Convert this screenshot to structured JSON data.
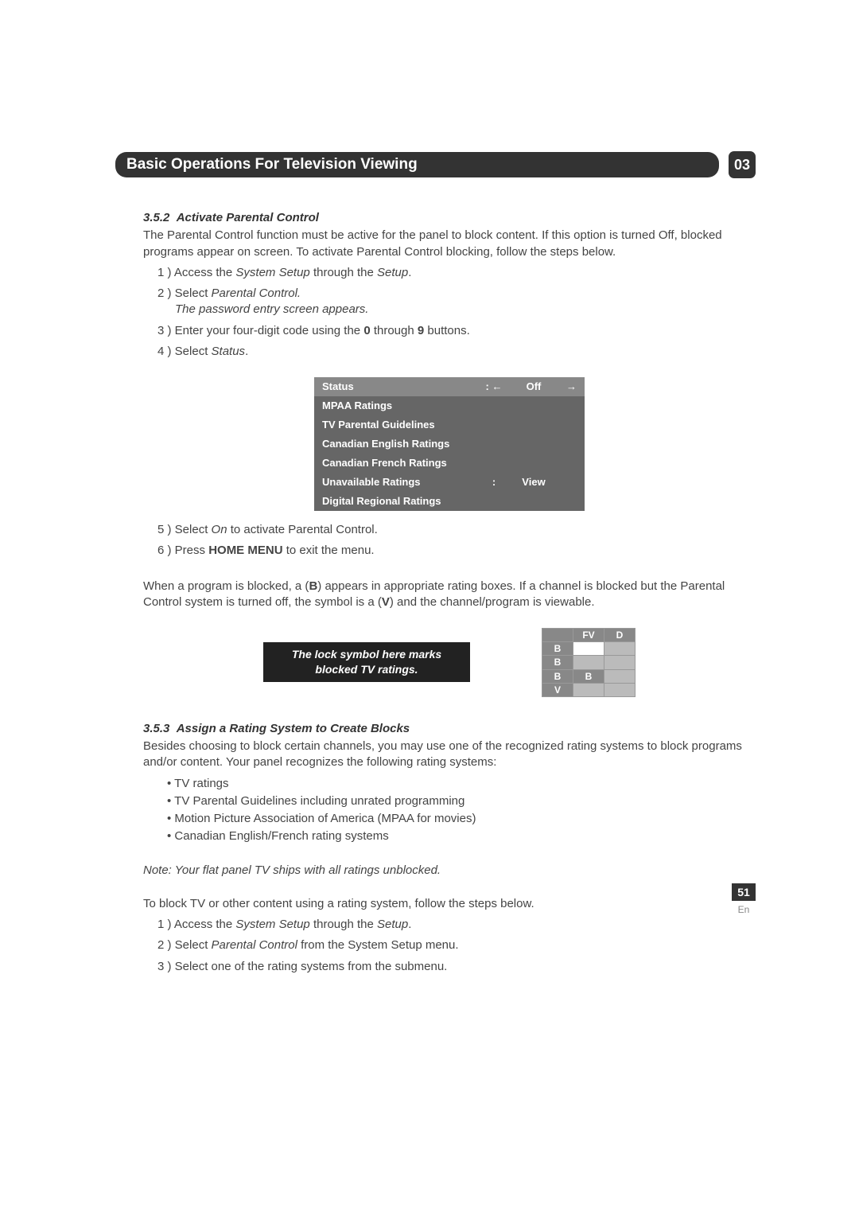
{
  "header": {
    "title": "Basic Operations For Television Viewing",
    "chapter": "03"
  },
  "section1": {
    "number": "3.5.2",
    "title": "Activate Parental Control",
    "intro": "The Parental Control function must be active for the panel to block content. If this option is turned Off, blocked programs appear on screen. To activate Parental Control blocking, follow the steps below.",
    "step1_a": "1 ) Access the ",
    "step1_b": "System Setup",
    "step1_c": " through the ",
    "step1_d": "Setup",
    "step1_e": ".",
    "step2_a": "2 ) Select ",
    "step2_b": "Parental Control.",
    "step2_note": "The password entry screen appears.",
    "step3_a": "3 ) Enter your four-digit code using the ",
    "step3_b": "0",
    "step3_c": " through ",
    "step3_d": "9",
    "step3_e": " buttons.",
    "step4_a": "4 ) Select ",
    "step4_b": "Status",
    "step4_c": ".",
    "step5_a": "5 ) Select ",
    "step5_b": "On",
    "step5_c": " to activate Parental Control.",
    "step6_a": "6 ) Press ",
    "step6_b": "HOME MENU",
    "step6_c": " to exit the menu.",
    "blocked_a": "When a program is blocked, a (",
    "blocked_b": "B",
    "blocked_c": ") appears in appropriate rating boxes. If a channel is blocked but the Parental Control system is turned off, the symbol is a (",
    "blocked_d": "V",
    "blocked_e": ") and the channel/program is viewable."
  },
  "menu": {
    "rows": [
      {
        "label": "Status",
        "arrow": ": ←",
        "value": "Off",
        "arrow2": "→",
        "hl": true
      },
      {
        "label": "MPAA Ratings",
        "arrow": "",
        "value": "",
        "arrow2": "",
        "hl": false
      },
      {
        "label": "TV Parental Guidelines",
        "arrow": "",
        "value": "",
        "arrow2": "",
        "hl": false
      },
      {
        "label": "Canadian English Ratings",
        "arrow": "",
        "value": "",
        "arrow2": "",
        "hl": false
      },
      {
        "label": "Canadian French Ratings",
        "arrow": "",
        "value": "",
        "arrow2": "",
        "hl": false
      },
      {
        "label": "Unavailable Ratings",
        "arrow": ":",
        "value": "View",
        "arrow2": "",
        "hl": false
      },
      {
        "label": "Digital Regional Ratings",
        "arrow": "",
        "value": "",
        "arrow2": "",
        "hl": false
      }
    ]
  },
  "callout": {
    "line1": "The lock symbol here marks",
    "line2": "blocked TV ratings."
  },
  "grid": {
    "h1": "FV",
    "h2": "D",
    "r1": "B",
    "r2": "B",
    "r3": "B",
    "r3b": "B",
    "r4": "V"
  },
  "section2": {
    "number": "3.5.3",
    "title": "Assign a Rating System to Create Blocks",
    "intro": "Besides choosing to block certain channels, you may use one of the recognized rating systems to block programs and/or content. Your panel recognizes the following rating systems:",
    "bullets": [
      "TV ratings",
      "TV Parental Guidelines including unrated programming",
      "Motion Picture Association of America (MPAA for movies)",
      "Canadian English/French rating systems"
    ],
    "note": "Note: Your flat panel TV ships with all ratings unblocked.",
    "lead": "To block TV or other content using a rating system, follow the steps below.",
    "step1_a": "1 ) Access the ",
    "step1_b": "System Setup",
    "step1_c": " through the ",
    "step1_d": "Setup",
    "step1_e": ".",
    "step2_a": "2 ) Select ",
    "step2_b": "Parental Control",
    "step2_c": " from the System Setup menu.",
    "step3": "3 ) Select one of the rating systems from the submenu."
  },
  "footer": {
    "page": "51",
    "lang": "En"
  }
}
